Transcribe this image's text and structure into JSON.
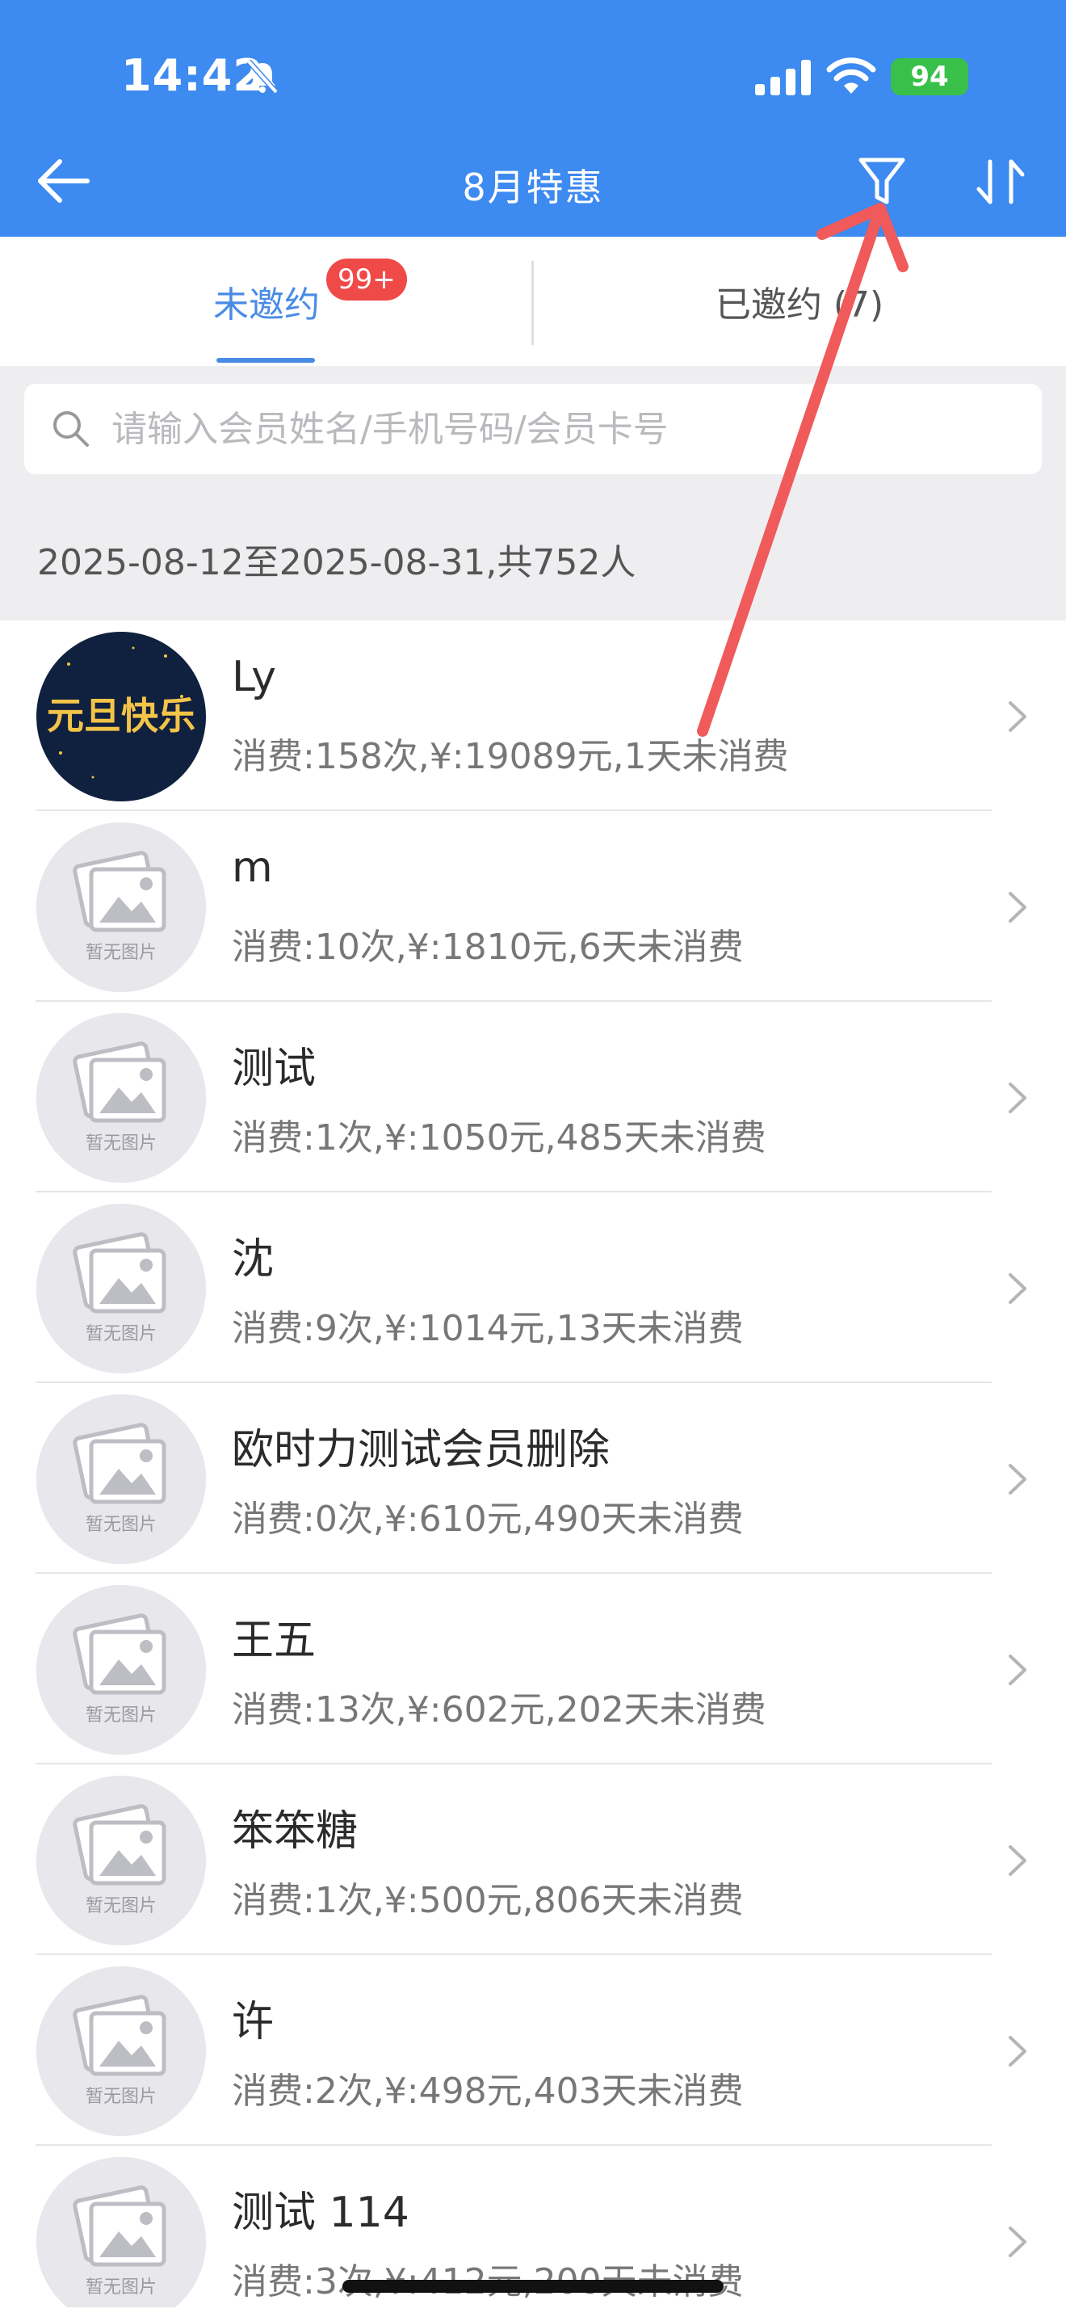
{
  "status_bar": {
    "time": "14:42",
    "battery": "94"
  },
  "nav": {
    "title": "8月特惠"
  },
  "tabs": {
    "uninvited_label": "未邀约",
    "uninvited_badge": "99+",
    "invited_label": "已邀约 (7)"
  },
  "search": {
    "placeholder": "请输入会员姓名/手机号码/会员卡号"
  },
  "summary": {
    "range_text": "2025-08-12至2025-08-31,共752人"
  },
  "members": [
    {
      "name": "Ly",
      "stats": "消费:158次,¥:19089元,1天未消费",
      "avatar": "custom"
    },
    {
      "name": "m",
      "stats": "消费:10次,¥:1810元,6天未消费",
      "avatar": "placeholder"
    },
    {
      "name": "测试",
      "stats": "消费:1次,¥:1050元,485天未消费",
      "avatar": "placeholder"
    },
    {
      "name": "沈",
      "stats": "消费:9次,¥:1014元,13天未消费",
      "avatar": "placeholder"
    },
    {
      "name": "欧时力测试会员删除",
      "stats": "消费:0次,¥:610元,490天未消费",
      "avatar": "placeholder"
    },
    {
      "name": "王五",
      "stats": "消费:13次,¥:602元,202天未消费",
      "avatar": "placeholder"
    },
    {
      "name": "笨笨糖",
      "stats": "消费:1次,¥:500元,806天未消费",
      "avatar": "placeholder"
    },
    {
      "name": "许",
      "stats": "消费:2次,¥:498元,403天未消费",
      "avatar": "placeholder"
    },
    {
      "name": "测试 114",
      "stats": "消费:3次,¥:412元,200天未消费",
      "avatar": "placeholder"
    }
  ],
  "placeholder_avatar_text": "暂无图片",
  "custom_avatar_text": "元旦快乐",
  "colors": {
    "header": "#3D8AF0",
    "accent": "#4A8BE6",
    "badge": "#F04A48",
    "annotation": "#F05A5A"
  }
}
